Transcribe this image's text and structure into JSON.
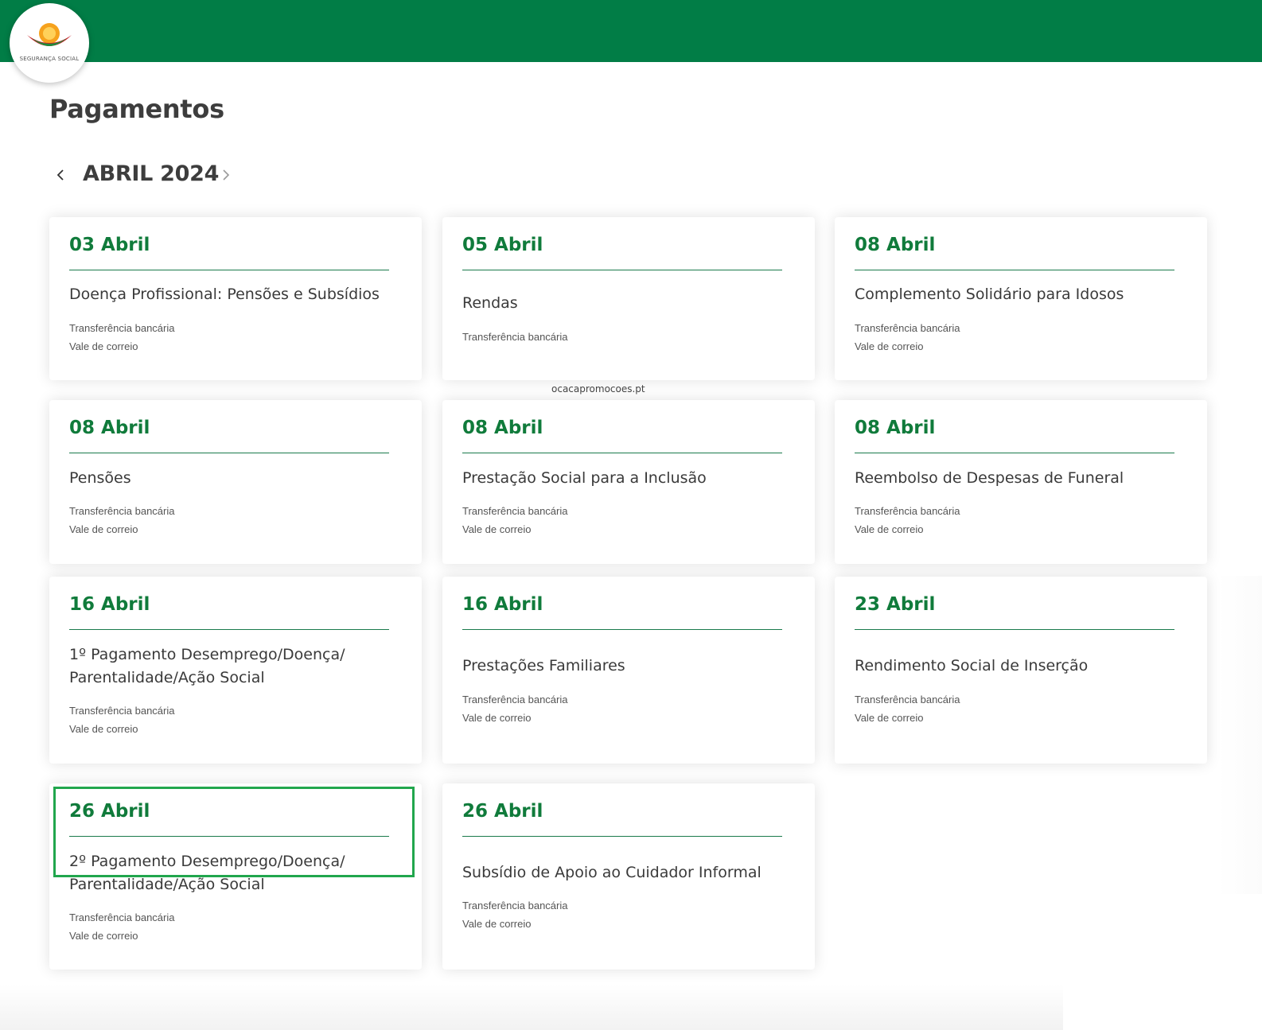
{
  "header": {
    "bar_color": "#017d46",
    "logo": {
      "icon": "seguranca-social-logo-icon",
      "text": "SEGURANÇA SOCIAL"
    }
  },
  "page": {
    "title": "Pagamentos"
  },
  "month_nav": {
    "label": "ABRIL 2024",
    "prev_icon": "chevron-left-icon",
    "next_icon": "chevron-right-icon"
  },
  "watermark": "ocacapromocoes.pt",
  "accent_color": "#107b3b",
  "highlight_color": "#21a64d",
  "cards": [
    {
      "date": "03 Abril",
      "title": "Doença Profissional: Pensões e Subsídios",
      "methods": [
        "Transferência bancária",
        "Vale de correio"
      ]
    },
    {
      "date": "05 Abril",
      "title": "Rendas",
      "methods": [
        "Transferência bancária"
      ]
    },
    {
      "date": "08 Abril",
      "title": "Complemento Solidário para Idosos",
      "methods": [
        "Transferência bancária",
        "Vale de correio"
      ]
    },
    {
      "date": "08 Abril",
      "title": "Pensões",
      "methods": [
        "Transferência bancária",
        "Vale de correio"
      ]
    },
    {
      "date": "08 Abril",
      "title": "Prestação Social para a Inclusão",
      "methods": [
        "Transferência bancária",
        "Vale de correio"
      ]
    },
    {
      "date": "08 Abril",
      "title": "Reembolso de Despesas de Funeral",
      "methods": [
        "Transferência bancária",
        "Vale de correio"
      ]
    },
    {
      "date": "16 Abril",
      "title": "1º Pagamento Desemprego/Doença/ Parentalidade/Ação Social",
      "methods": [
        "Transferência bancária",
        "Vale de correio"
      ]
    },
    {
      "date": "16 Abril",
      "title": "Prestações Familiares",
      "methods": [
        "Transferência bancária",
        "Vale de correio"
      ]
    },
    {
      "date": "23 Abril",
      "title": "Rendimento Social de Inserção",
      "methods": [
        "Transferência bancária",
        "Vale de correio"
      ]
    },
    {
      "date": "26 Abril",
      "title": "2º Pagamento Desemprego/Doença/ Parentalidade/Ação Social",
      "methods": [
        "Transferência bancária",
        "Vale de correio"
      ]
    },
    {
      "date": "26 Abril",
      "title": "Subsídio de Apoio ao Cuidador Informal",
      "methods": [
        "Transferência bancária",
        "Vale de correio"
      ]
    }
  ]
}
